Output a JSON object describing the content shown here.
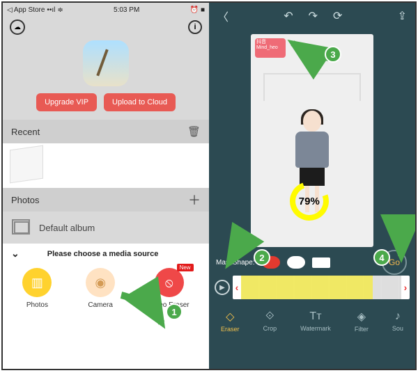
{
  "status": {
    "back": "App Store",
    "signal": "••ıl",
    "wifi": "≑",
    "time": "5:03 PM",
    "alarm": "⏰",
    "battery": "■"
  },
  "left_actions": {
    "upgrade": "Upgrade VIP",
    "upload": "Upload to Cloud"
  },
  "sections": {
    "recent": "Recent",
    "photos": "Photos",
    "default_album": "Default album"
  },
  "sheet": {
    "prompt": "Please choose a media source"
  },
  "media_options": [
    {
      "label": "Photos",
      "icon": "photo-icon"
    },
    {
      "label": "Camera",
      "icon": "camera-icon"
    },
    {
      "label": "Video Eraser",
      "icon": "eraser-icon",
      "badge": "New"
    }
  ],
  "right": {
    "watermark": "抖音",
    "watermark_sub": "Mind_heo",
    "progress": "79%",
    "mask_label": "MaskShape:",
    "go": "Go",
    "tools": [
      {
        "label": "Eraser",
        "active": true
      },
      {
        "label": "Crop",
        "active": false
      },
      {
        "label": "Watermark",
        "active": false
      },
      {
        "label": "Filter",
        "active": false
      },
      {
        "label": "Sou",
        "active": false
      }
    ]
  },
  "annotations": {
    "n1": "1",
    "n2": "2",
    "n3": "3",
    "n4": "4"
  }
}
